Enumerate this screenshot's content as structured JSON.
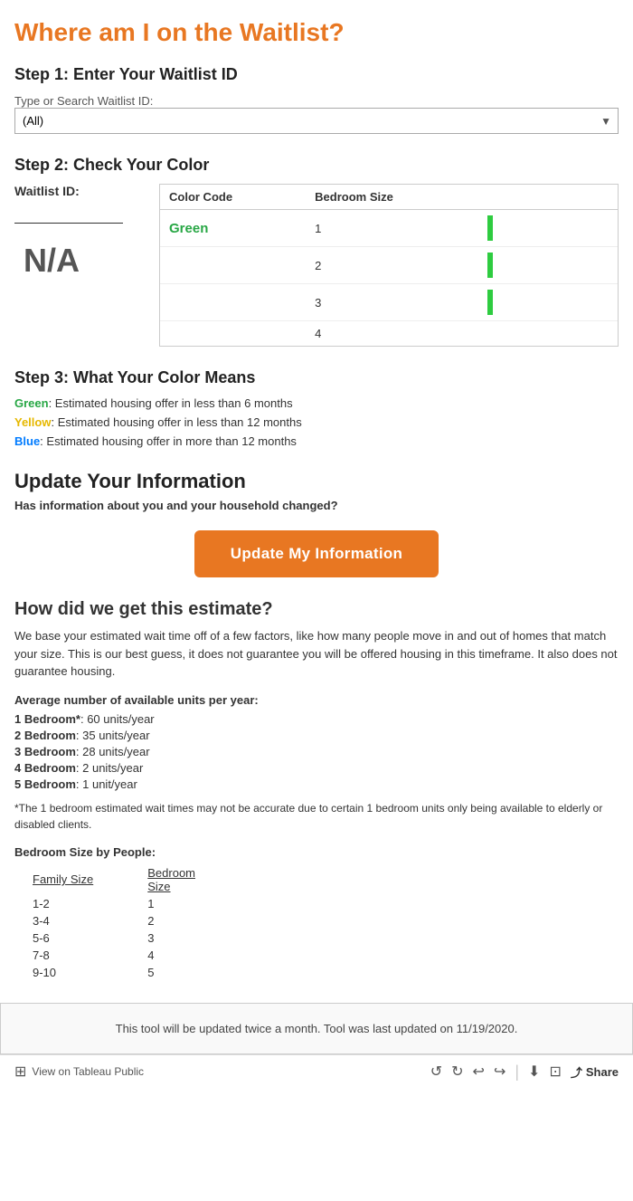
{
  "header": {
    "title": "Where am I on the Waitlist?"
  },
  "step1": {
    "heading": "Step 1: Enter Your Waitlist ID",
    "label": "Type or Search Waitlist ID:",
    "select_default": "(All)"
  },
  "step2": {
    "heading": "Step 2: Check Your Color",
    "waitlist_id_label": "Waitlist ID:",
    "na_value": "N/A",
    "table": {
      "col1": "Color Code",
      "col2": "Bedroom Size",
      "rows": [
        {
          "color": "Green",
          "bedroom": "1",
          "has_bar": true
        },
        {
          "color": "",
          "bedroom": "2",
          "has_bar": true
        },
        {
          "color": "",
          "bedroom": "3",
          "has_bar": true
        },
        {
          "color": "",
          "bedroom": "4",
          "has_bar": false
        }
      ]
    }
  },
  "step3": {
    "heading": "Step 3: What Your Color Means",
    "items": [
      {
        "color_label": "Green",
        "color_key": "green",
        "description": ": Estimated housing offer in less than 6 months"
      },
      {
        "color_label": "Yellow",
        "color_key": "yellow",
        "description": ": Estimated housing offer in less than 12 months"
      },
      {
        "color_label": "Blue",
        "color_key": "blue",
        "description": ": Estimated housing offer in more than 12 months"
      }
    ]
  },
  "update": {
    "heading": "Update Your Information",
    "subtext": "Has information about you and your household changed?",
    "button_label": "Update My Information"
  },
  "estimate": {
    "heading": "How did we get this estimate?",
    "description": "We base your estimated wait time off of a few factors, like how many people move in and out of homes that match your size. This is our best guess, it does not guarantee you will be offered housing in this timeframe. It also does not guarantee housing.",
    "avg_heading": "Average number of available units per year:",
    "units": [
      {
        "label": "1 Bedroom*",
        "value": ": 60 units/year"
      },
      {
        "label": "2 Bedroom",
        "value": ": 35 units/year"
      },
      {
        "label": "3 Bedroom",
        "value": ": 28 units/year"
      },
      {
        "label": "4 Bedroom",
        "value": ": 2 units/year"
      },
      {
        "label": "5 Bedroom",
        "value": ": 1 unit/year"
      }
    ],
    "footnote": "*The 1 bedroom estimated wait times may not be accurate due to certain 1 bedroom units only being available to elderly or disabled clients.",
    "bedroom_heading": "Bedroom Size by People:",
    "family_table": {
      "col1": "Family Size",
      "col2": "Bedroom Size",
      "rows": [
        {
          "family": "1-2",
          "bedroom": "1"
        },
        {
          "family": "3-4",
          "bedroom": "2"
        },
        {
          "family": "5-6",
          "bedroom": "3"
        },
        {
          "family": "7-8",
          "bedroom": "4"
        },
        {
          "family": "9-10",
          "bedroom": "5"
        }
      ]
    }
  },
  "footer": {
    "note": "This tool will be updated twice a month. Tool was last updated on 11/19/2020."
  },
  "tableau_bar": {
    "label": "View on Tableau Public",
    "share_label": "Share"
  }
}
